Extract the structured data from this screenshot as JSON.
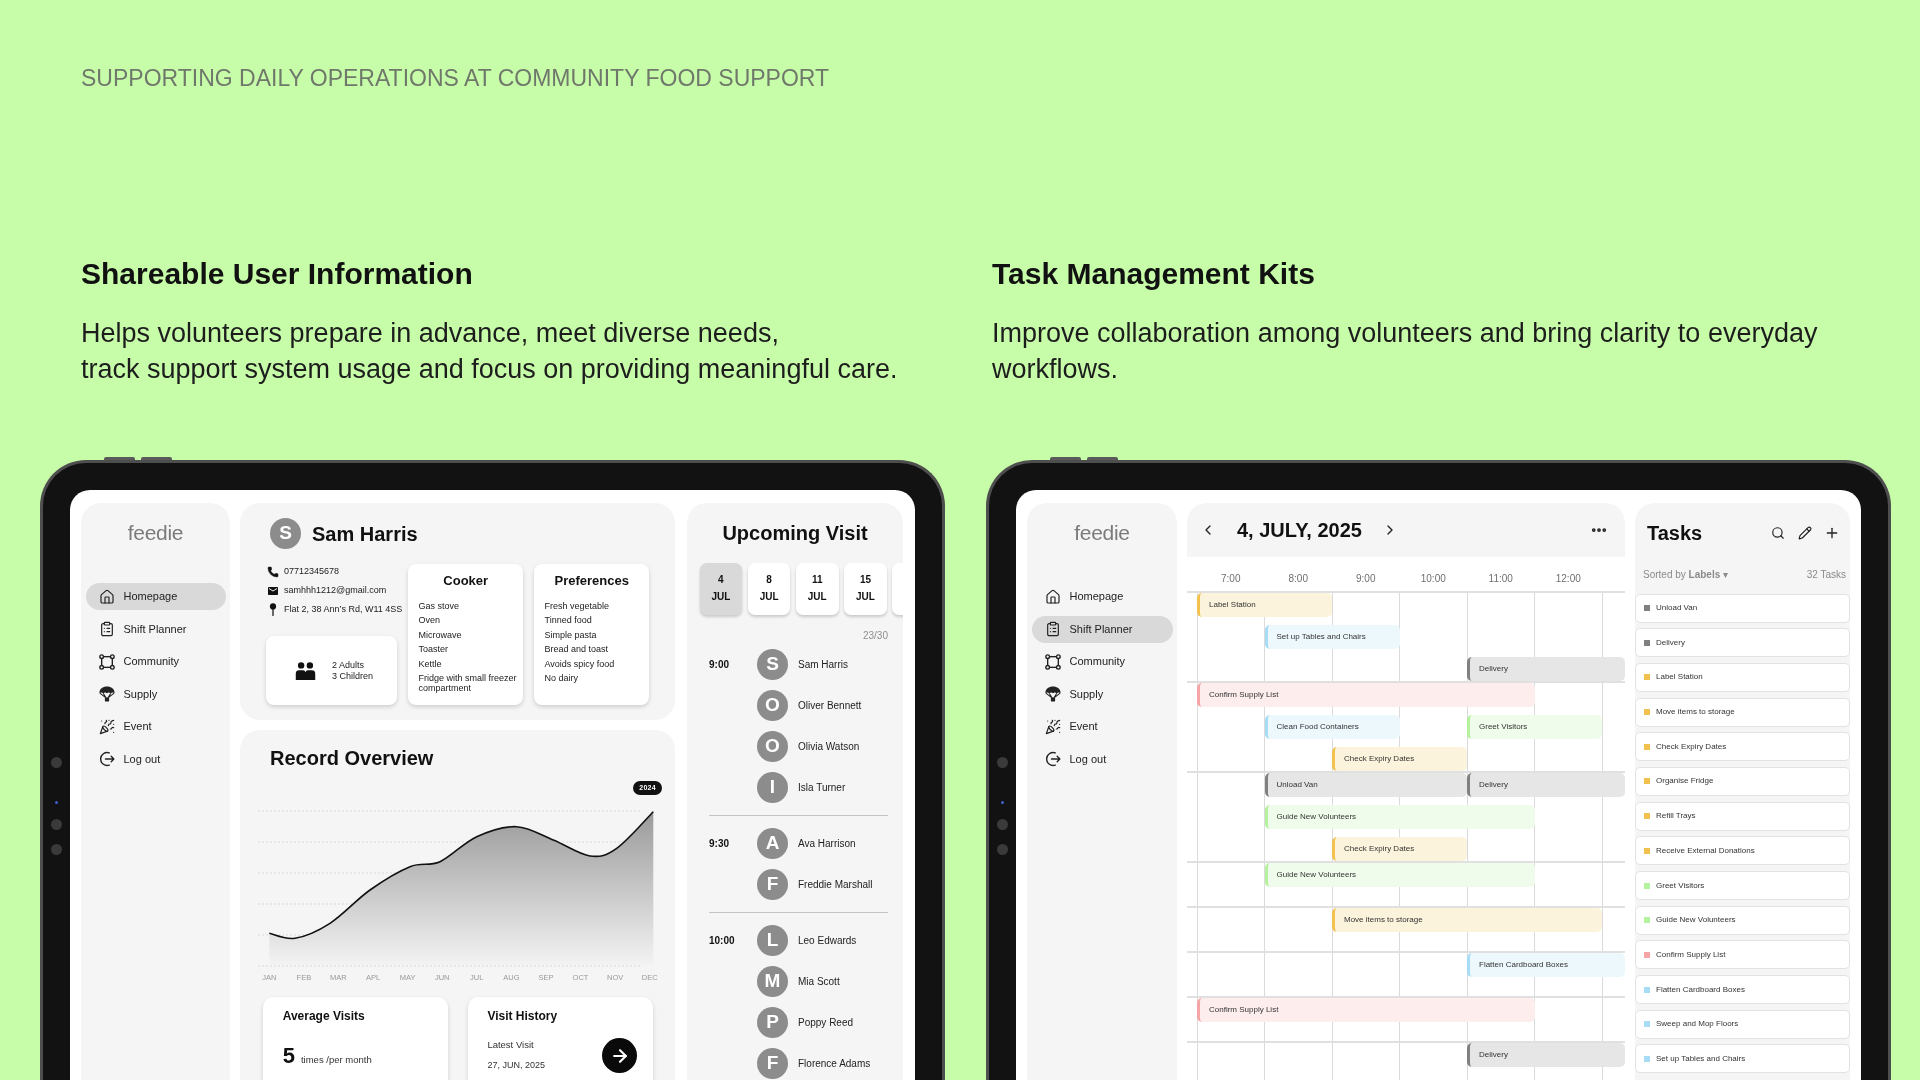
{
  "header": {
    "eyebrow": "SUPPORTING DAILY OPERATIONS AT COMMUNITY FOOD SUPPORT"
  },
  "sections": [
    {
      "title": "Shareable User Information",
      "description": "Helps volunteers prepare in advance, meet diverse needs,\ntrack support system usage and focus on providing meaningful care."
    },
    {
      "title": "Task Management Kits",
      "description": "Improve collaboration among volunteers and bring clarity to everyday\nworkflows."
    }
  ],
  "profile_screen": {
    "sidebar": {
      "logo": "feedie",
      "items": [
        {
          "label": "Homepage",
          "selected": true
        },
        {
          "label": "Shift Planner",
          "selected": false
        },
        {
          "label": "Community",
          "selected": false
        },
        {
          "label": "Supply",
          "selected": false
        },
        {
          "label": "Event",
          "selected": false
        },
        {
          "label": "Log out",
          "selected": false
        }
      ]
    },
    "profile": {
      "initial": "S",
      "name": "Sam Harris",
      "contacts": [
        {
          "kind": "phone",
          "text": "07712345678"
        },
        {
          "kind": "email",
          "text": "samhhh1212@gmail.com"
        },
        {
          "kind": "address",
          "text": "Flat 2, 38 Ann’s Rd, W11 4SS"
        }
      ],
      "household": [
        "2 Adults",
        "3 Children"
      ],
      "cards": [
        {
          "title": "Cooker",
          "items": [
            "Gas stove",
            "Oven",
            "Microwave",
            "Toaster",
            "Kettle",
            "Fridge with small freezer compartment"
          ]
        },
        {
          "title": "Preferences",
          "items": [
            "Fresh vegetable",
            "Tinned food",
            "Simple pasta",
            "Bread and toast",
            "Avoids spicy food",
            "No dairy"
          ]
        }
      ]
    },
    "record_overview": {
      "title": "Record Overview",
      "year": "2024",
      "months": [
        "JAN",
        "FEB",
        "MAR",
        "APL",
        "MAY",
        "JUN",
        "JUL",
        "AUG",
        "SEP",
        "OCT",
        "NOV",
        "DEC"
      ],
      "average_visits": {
        "title": "Average Visits",
        "value": "5",
        "unit": "times /per month"
      },
      "visit_history": {
        "title": "Visit History",
        "label": "Latest Visit",
        "date": "27, JUN, 2025"
      }
    },
    "upcoming_visit": {
      "title": "Upcoming Visit",
      "dates": [
        {
          "day": "4",
          "month": "JUL",
          "selected": true
        },
        {
          "day": "8",
          "month": "JUL",
          "selected": false
        },
        {
          "day": "11",
          "month": "JUL",
          "selected": false
        },
        {
          "day": "15",
          "month": "JUL",
          "selected": false
        },
        {
          "selected": false
        }
      ],
      "capacity": "23/30",
      "slots": [
        {
          "time": "9:00",
          "visitors": [
            {
              "initial": "S",
              "name": "Sam Harris"
            },
            {
              "initial": "O",
              "name": "Oliver Bennett"
            },
            {
              "initial": "O",
              "name": "Olivia Watson"
            },
            {
              "initial": "I",
              "name": "Isla Turner"
            }
          ]
        },
        {
          "time": "9:30",
          "visitors": [
            {
              "initial": "A",
              "name": "Ava Harrison"
            },
            {
              "initial": "F",
              "name": "Freddie Marshall"
            }
          ]
        },
        {
          "time": "10:00",
          "visitors": [
            {
              "initial": "L",
              "name": "Leo Edwards"
            },
            {
              "initial": "M",
              "name": "Mia Scott"
            },
            {
              "initial": "P",
              "name": "Poppy Reed"
            },
            {
              "initial": "F",
              "name": "Florence Adams"
            }
          ]
        }
      ]
    }
  },
  "planner_screen": {
    "sidebar": {
      "logo": "feedie",
      "items": [
        {
          "label": "Homepage",
          "selected": false
        },
        {
          "label": "Shift Planner",
          "selected": true
        },
        {
          "label": "Community",
          "selected": false
        },
        {
          "label": "Supply",
          "selected": false
        },
        {
          "label": "Event",
          "selected": false
        },
        {
          "label": "Log out",
          "selected": false
        }
      ]
    },
    "calendar": {
      "date": "4, JULY, 2025",
      "times": [
        "7:00",
        "8:00",
        "9:00",
        "10:00",
        "11:00",
        "12:00"
      ],
      "rows": [
        {
          "lanes": [
            [
              {
                "kind": "event",
                "label": "Label Station",
                "color": "#f2c14e"
              },
              {
                "kind": "continued"
              }
            ],
            [
              {
                "kind": "empty"
              },
              {
                "kind": "event",
                "label": "Set up Tables and Chairs",
                "color": "#a6dcf5"
              },
              {
                "kind": "continued"
              }
            ],
            [
              {
                "kind": "empty"
              },
              {
                "kind": "empty"
              },
              {
                "kind": "empty"
              },
              {
                "kind": "empty"
              },
              {
                "kind": "event",
                "label": "Delivery",
                "color": "#808080"
              },
              {
                "kind": "continued"
              },
              {
                "kind": "continued"
              }
            ]
          ]
        },
        {
          "lanes": [
            [
              {
                "kind": "event",
                "label": "Confirm Supply List",
                "color": "#f5a5a5"
              },
              {
                "kind": "continued"
              },
              {
                "kind": "continued"
              },
              {
                "kind": "continued"
              },
              {
                "kind": "continued"
              }
            ],
            [
              {
                "kind": "empty"
              },
              {
                "kind": "event",
                "label": "Clean Food Containers",
                "color": "#a6dcf5"
              },
              {
                "kind": "continued"
              },
              {
                "kind": "empty"
              },
              {
                "kind": "event",
                "label": "Greet Visitors",
                "color": "#b5f29d"
              },
              {
                "kind": "continued"
              }
            ],
            [
              {
                "kind": "empty"
              },
              {
                "kind": "empty"
              },
              {
                "kind": "event",
                "label": "Check Expiry Dates",
                "color": "#f2c14e"
              },
              {
                "kind": "continued"
              }
            ]
          ]
        },
        {
          "lanes": [
            [
              {
                "kind": "empty"
              },
              {
                "kind": "event",
                "label": "Unload Van",
                "color": "#808080"
              },
              {
                "kind": "continued"
              },
              {
                "kind": "continued"
              },
              {
                "kind": "event",
                "label": "Delivery",
                "color": "#808080"
              },
              {
                "kind": "continued"
              },
              {
                "kind": "continued"
              }
            ],
            [
              {
                "kind": "empty"
              },
              {
                "kind": "event",
                "label": "Guide New Volunteers",
                "color": "#b5f29d"
              },
              {
                "kind": "continued"
              },
              {
                "kind": "continued"
              },
              {
                "kind": "continued"
              }
            ],
            [
              {
                "kind": "empty"
              },
              {
                "kind": "empty"
              },
              {
                "kind": "event",
                "label": "Check Expiry Dates",
                "color": "#f2c14e"
              },
              {
                "kind": "continued"
              }
            ]
          ]
        },
        {
          "lanes": [
            [
              {
                "kind": "empty"
              },
              {
                "kind": "event",
                "label": "Guide New Volunteers",
                "color": "#b5f29d"
              },
              {
                "kind": "continued"
              },
              {
                "kind": "continued"
              },
              {
                "kind": "continued"
              }
            ]
          ]
        },
        {
          "lanes": [
            [
              {
                "kind": "empty"
              },
              {
                "kind": "empty"
              },
              {
                "kind": "event",
                "label": "Move items to storage",
                "color": "#f2c14e"
              },
              {
                "kind": "continued"
              },
              {
                "kind": "continued"
              },
              {
                "kind": "continued"
              }
            ]
          ]
        },
        {
          "lanes": [
            [
              {
                "kind": "empty"
              },
              {
                "kind": "empty"
              },
              {
                "kind": "empty"
              },
              {
                "kind": "empty"
              },
              {
                "kind": "event",
                "label": "Flatten Cardboard Boxes",
                "color": "#a6dcf5"
              },
              {
                "kind": "continued"
              },
              {
                "kind": "continued"
              }
            ]
          ]
        },
        {
          "lanes": [
            [
              {
                "kind": "event",
                "label": "Confirm Supply List",
                "color": "#f5a5a5"
              },
              {
                "kind": "continued"
              },
              {
                "kind": "continued"
              },
              {
                "kind": "continued"
              },
              {
                "kind": "continued"
              }
            ]
          ]
        },
        {
          "lanes": [
            [
              {
                "kind": "empty"
              },
              {
                "kind": "empty"
              },
              {
                "kind": "empty"
              },
              {
                "kind": "empty"
              },
              {
                "kind": "event",
                "label": "Delivery",
                "color": "#808080"
              },
              {
                "kind": "continued"
              },
              {
                "kind": "continued"
              }
            ]
          ]
        }
      ]
    },
    "tasks": {
      "title": "Tasks",
      "sort": "Sorted by **Labels** ▾",
      "count": "32 Tasks",
      "items": [
        {
          "label": "Unload Van",
          "color": "#808080"
        },
        {
          "label": "Delivery",
          "color": "#808080"
        },
        {
          "label": "Label Station",
          "color": "#f2c14e"
        },
        {
          "label": "Move items to storage",
          "color": "#f2c14e"
        },
        {
          "label": "Check Expiry Dates",
          "color": "#f2c14e"
        },
        {
          "label": "Organise Fridge",
          "color": "#f2c14e"
        },
        {
          "label": "Refill Trays",
          "color": "#f2c14e"
        },
        {
          "label": "Receive External Donations",
          "color": "#f2c14e"
        },
        {
          "label": "Greet Visitors",
          "color": "#b5f29d"
        },
        {
          "label": "Guide New Volunteers",
          "color": "#b5f29d"
        },
        {
          "label": "Confirm Supply List",
          "color": "#f5a5a5"
        },
        {
          "label": "Flatten Cardboard Boxes",
          "color": "#a6dcf5"
        },
        {
          "label": "Sweep and Mop Floors",
          "color": "#a6dcf5"
        },
        {
          "label": "Set up Tables and Chairs",
          "color": "#a6dcf5"
        }
      ]
    }
  }
}
